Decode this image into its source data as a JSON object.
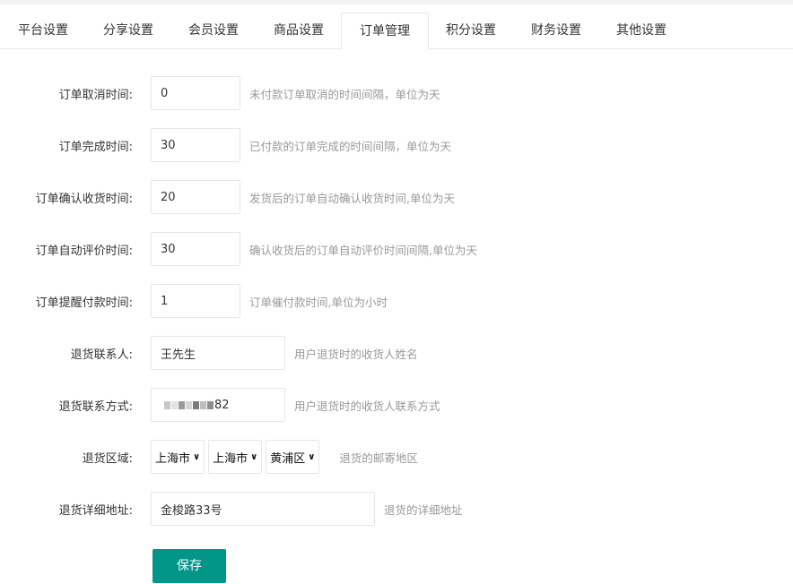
{
  "tabs": [
    "平台设置",
    "分享设置",
    "会员设置",
    "商品设置",
    "订单管理",
    "积分设置",
    "财务设置",
    "其他设置"
  ],
  "active_tab_index": 4,
  "form": {
    "cancel_time": {
      "label": "订单取消时间:",
      "value": "0",
      "hint": "未付款订单取消的时间间隔，单位为天"
    },
    "complete_time": {
      "label": "订单完成时间:",
      "value": "30",
      "hint": "已付款的订单完成的时间间隔，单位为天"
    },
    "confirm_time": {
      "label": "订单确认收货时间:",
      "value": "20",
      "hint": "发货后的订单自动确认收货时间,单位为天"
    },
    "review_time": {
      "label": "订单自动评价时间:",
      "value": "30",
      "hint": "确认收货后的订单自动评价时间间隔,单位为天"
    },
    "remind_time": {
      "label": "订单提醒付款时间:",
      "value": "1",
      "hint": "订单催付款时间,单位为小时"
    },
    "return_contact": {
      "label": "退货联系人:",
      "value": "王先生",
      "hint": "用户退货时的收货人姓名"
    },
    "return_phone": {
      "label": "退货联系方式:",
      "value_suffix": "82",
      "hint": "用户退货时的收货人联系方式"
    },
    "return_region": {
      "label": "退货区域:",
      "province": "上海市",
      "city": "上海市",
      "district": "黄浦区",
      "hint": "退货的邮寄地区"
    },
    "return_address": {
      "label": "退货详细地址:",
      "value": "金梭路33号",
      "hint": "退货的详细地址"
    }
  },
  "save_button": "保存",
  "colors": {
    "primary": "#009688",
    "border": "#e6e6e6",
    "hint": "#999999"
  }
}
